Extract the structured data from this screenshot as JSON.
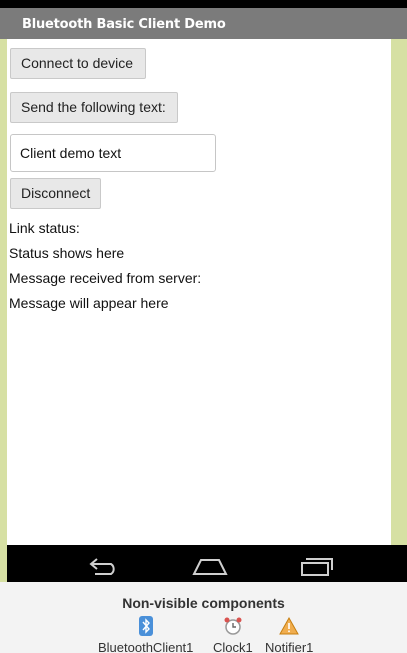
{
  "app": {
    "title": "Bluetooth Basic Client Demo"
  },
  "buttons": {
    "connect": "Connect to device",
    "send": "Send the following text:",
    "disconnect": "Disconnect"
  },
  "textbox": {
    "value": "Client demo text"
  },
  "labels": {
    "link_status": "Link status:",
    "status": "Status shows here",
    "message_received": "Message received from server:",
    "message": "Message will appear here"
  },
  "nonvisible": {
    "title": "Non-visible components",
    "components": [
      {
        "name": "BluetoothClient1",
        "icon": "bluetooth-icon"
      },
      {
        "name": "Clock1",
        "icon": "clock-icon"
      },
      {
        "name": "Notifier1",
        "icon": "warning-icon"
      }
    ]
  },
  "colors": {
    "title_bar": "#7b7b7b",
    "frame": "#d6e0a3",
    "nav_bar": "#000000"
  }
}
